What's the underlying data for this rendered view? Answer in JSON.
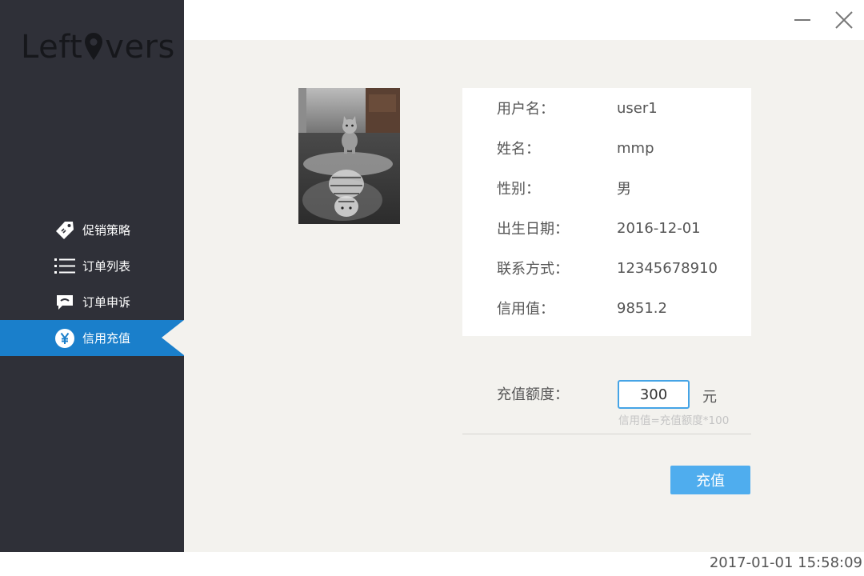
{
  "app": {
    "logo_prefix": "Left",
    "logo_suffix": "vers"
  },
  "sidebar": {
    "items": [
      {
        "label": "促销策略",
        "icon": "price-tag-icon",
        "active": false
      },
      {
        "label": "订单列表",
        "icon": "list-icon",
        "active": false
      },
      {
        "label": "订单申诉",
        "icon": "chat-bubble-icon",
        "active": false
      },
      {
        "label": "信用充值",
        "icon": "yen-coin-icon",
        "active": true
      }
    ]
  },
  "window": {
    "minimize_icon": "minimize-icon",
    "close_icon": "close-icon"
  },
  "profile": {
    "avatar_alt": "cat-tiger-reflection-image",
    "fields": [
      {
        "label": "用户名：",
        "value": "user1"
      },
      {
        "label": "姓名：",
        "value": "mmp"
      },
      {
        "label": "性别：",
        "value": "男"
      },
      {
        "label": "出生日期：",
        "value": "2016-12-01"
      },
      {
        "label": "联系方式：",
        "value": "12345678910"
      },
      {
        "label": "信用值：",
        "value": "9851.2"
      }
    ]
  },
  "recharge": {
    "label": "充值额度：",
    "amount": "300",
    "unit": "元",
    "hint": "信用值=充值额度*100",
    "button_label": "充值"
  },
  "status": {
    "timestamp": "2017-01-01 15:58:09"
  },
  "colors": {
    "sidebar_bg": "#2f3038",
    "active_bg": "#1a7fcb",
    "main_bg": "#f3f2ee",
    "button_bg": "#4fadee",
    "input_border": "#45a4e6"
  }
}
